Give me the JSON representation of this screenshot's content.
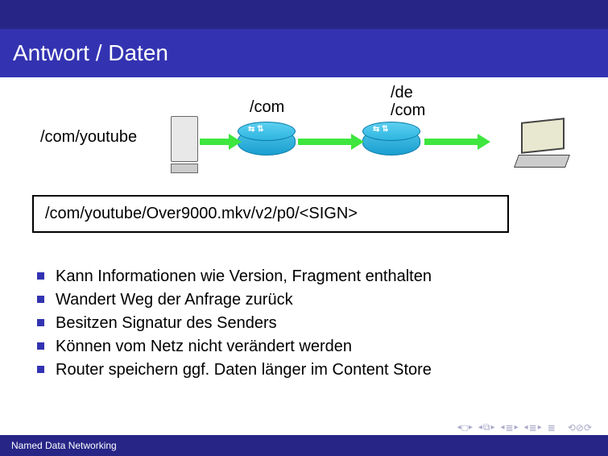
{
  "title": "Antwort / Daten",
  "diagram": {
    "server_label": "/com/youtube",
    "router1_label": "/com",
    "router2_label": "/de\n/com"
  },
  "data_path": "/com/youtube/Over9000.mkv/v2/p0/<SIGN>",
  "bullets": [
    "Kann Informationen wie Version, Fragment enthalten",
    "Wandert Weg der Anfrage zurück",
    "Besitzen Signatur des Senders",
    "Können vom Netz nicht verändert werden",
    "Router speichern ggf. Daten länger im Content Store"
  ],
  "footer": "Named Data Networking"
}
